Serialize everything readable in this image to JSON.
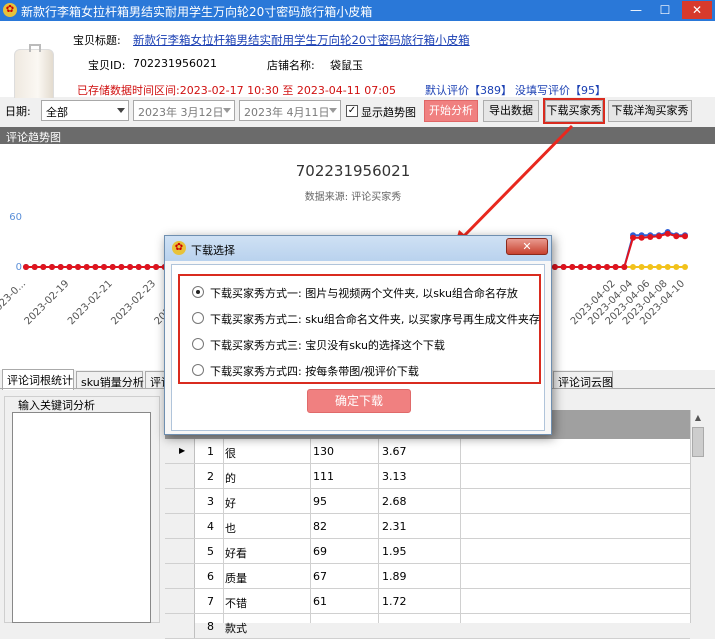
{
  "window": {
    "title": "新款行李箱女拉杆箱男结实耐用学生万向轮20寸密码旅行箱小皮箱",
    "controls": {
      "minimize": "—",
      "maximize": "☐",
      "close": "✕"
    }
  },
  "product": {
    "title_label": "宝贝标题:",
    "title_value": "新款行李箱女拉杆箱男结实耐用学生万向轮20寸密码旅行箱小皮箱",
    "id_label": "宝贝ID:",
    "id_value": "702231956021",
    "shop_label": "店铺名称:",
    "shop_value": "袋鼠玉",
    "stored_range": "已存储数据时间区间:2023-02-17 10:30 至 2023-04-11 07:05",
    "default_reviews": "默认评价【389】",
    "unwritten_reviews": "没填写评价【95】"
  },
  "toolbar": {
    "date_label": "日期:",
    "date_select": "全部",
    "start_date": "2023年 3月12日",
    "end_date": "2023年 4月11日",
    "show_trend_label": "显示趋势图",
    "show_trend_checked": true,
    "start_analysis": "开始分析",
    "export_data": "导出数据",
    "download_buyer_show": "下载买家秀",
    "download_foreign_buyer_show": "下载洋淘买家秀"
  },
  "chart_header": "评论趋势图",
  "chart_data": {
    "type": "line",
    "title": "702231956021",
    "subtitle": "数据来源: 评论买家秀",
    "xlabel": "",
    "ylabel": "",
    "y_ticks": [
      "60",
      "0"
    ],
    "ylim": [
      0,
      60
    ],
    "x_ticks": [
      "2023-0...",
      "2023-02-19",
      "2023-02-21",
      "2023-02-23",
      "2023-02-25",
      "2023-04-02",
      "2023-04-04",
      "2023-04-06",
      "2023-04-08",
      "2023-04-10"
    ],
    "series": [
      {
        "color": "#e0141e",
        "values": [
          0,
          0,
          0,
          0,
          0,
          0,
          0,
          0,
          0,
          0,
          0,
          0,
          0,
          0,
          0,
          0,
          0,
          0,
          0,
          0,
          0,
          0,
          0,
          0,
          0,
          0,
          0,
          0,
          0,
          0,
          0,
          0,
          0,
          0,
          0,
          0,
          0,
          0,
          0,
          0,
          0,
          0,
          0,
          0,
          0,
          0,
          0,
          0,
          0,
          0,
          0,
          0,
          0,
          0,
          0,
          0,
          0,
          0,
          0,
          0,
          0,
          0,
          0,
          0,
          0,
          0,
          0,
          0,
          0,
          0,
          35,
          35,
          36,
          37,
          40,
          37,
          37
        ]
      },
      {
        "color": "#2e5fd6",
        "values": [
          0,
          0,
          0,
          0,
          0,
          0,
          0,
          0,
          0,
          0,
          0,
          0,
          0,
          0,
          0,
          0,
          0,
          0,
          0,
          0,
          0,
          0,
          0,
          0,
          0,
          0,
          0,
          0,
          0,
          0,
          0,
          0,
          0,
          0,
          0,
          0,
          0,
          0,
          0,
          0,
          0,
          0,
          0,
          0,
          0,
          0,
          0,
          0,
          0,
          0,
          0,
          0,
          0,
          0,
          0,
          0,
          0,
          0,
          0,
          0,
          0,
          0,
          0,
          0,
          0,
          0,
          0,
          0,
          0,
          0,
          38,
          38,
          38,
          38,
          42,
          38,
          38
        ]
      },
      {
        "color": "#f2c21b",
        "values": [
          0,
          0,
          0,
          0,
          0,
          0,
          0,
          0,
          0,
          0,
          0,
          0,
          0,
          0,
          0,
          0,
          0,
          0,
          0,
          0,
          0,
          0,
          0,
          0,
          0,
          0,
          0,
          0,
          0,
          0,
          0,
          0,
          0,
          0,
          0,
          0,
          0,
          0,
          0,
          0,
          0,
          0,
          0,
          0,
          0,
          0,
          0,
          0,
          0,
          0,
          0,
          0,
          0,
          0,
          0,
          0,
          0,
          0,
          0,
          0,
          0,
          0,
          0,
          0,
          0,
          0,
          0,
          0,
          0,
          0,
          0,
          0,
          0,
          0,
          0,
          0,
          0
        ]
      }
    ]
  },
  "tabs": [
    "评论词根统计",
    "sku销量分析",
    "评论",
    "评论词云图"
  ],
  "keyword_group_title": "输入关键词分析",
  "table": {
    "rows": [
      {
        "idx": "1",
        "word": "很",
        "count": "130",
        "pct": "3.67"
      },
      {
        "idx": "2",
        "word": "的",
        "count": "111",
        "pct": "3.13"
      },
      {
        "idx": "3",
        "word": "好",
        "count": "95",
        "pct": "2.68"
      },
      {
        "idx": "4",
        "word": "也",
        "count": "82",
        "pct": "2.31"
      },
      {
        "idx": "5",
        "word": "好看",
        "count": "69",
        "pct": "1.95"
      },
      {
        "idx": "6",
        "word": "质量",
        "count": "67",
        "pct": "1.89"
      },
      {
        "idx": "7",
        "word": "不错",
        "count": "61",
        "pct": "1.72"
      },
      {
        "idx": "8",
        "word": "款式",
        "count": "",
        "pct": ""
      }
    ]
  },
  "dialog": {
    "title": "下载选择",
    "options": [
      "下载买家秀方式一: 图片与视频两个文件夹, 以sku组合命名存放",
      "下载买家秀方式二: sku组合命名文件夹, 以买家序号再生成文件夹存放",
      "下载买家秀方式三: 宝贝没有sku的选择这个下载",
      "下载买家秀方式四: 按每条带图/视评价下载"
    ],
    "selected_index": 0,
    "confirm": "确定下载"
  },
  "colors": {
    "accent_red": "#d92b1f",
    "button_pink": "#f08080",
    "titlebar_blue": "#2a78d8",
    "link_blue": "#1a3fb3"
  }
}
